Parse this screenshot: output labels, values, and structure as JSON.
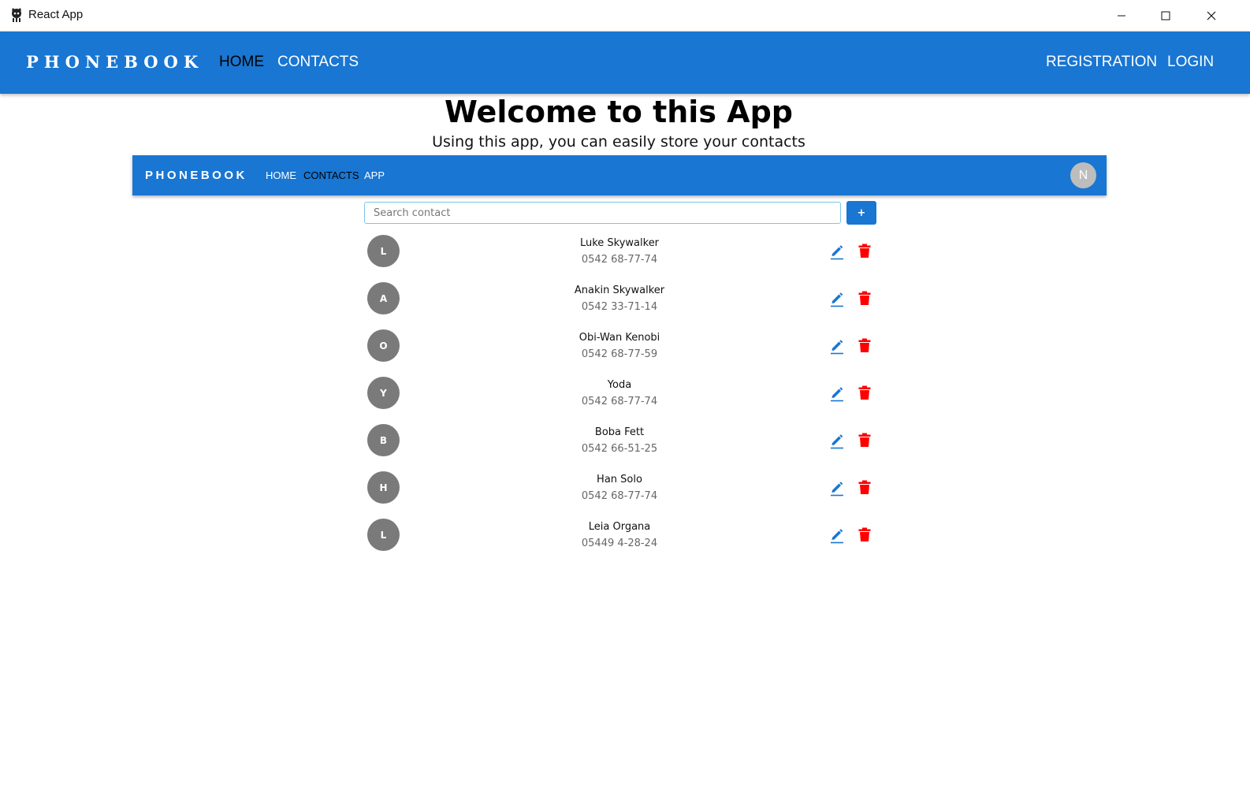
{
  "window": {
    "title": "React App"
  },
  "colors": {
    "primary": "#1976d2",
    "danger": "#ff0000",
    "avatar": "#7a7a7a",
    "text": "#111111"
  },
  "header": {
    "brand": "PHONEBOOK",
    "nav": [
      {
        "label": "HOME",
        "active": true
      },
      {
        "label": "CONTACTS",
        "active": false
      }
    ],
    "auth": [
      {
        "label": "REGISTRATION"
      },
      {
        "label": "LOGIN"
      }
    ]
  },
  "hero": {
    "title": "Welcome to this App",
    "subtitle": "Using this app, you can easily store your contacts"
  },
  "inner_app": {
    "brand": "PHONEBOOK",
    "nav": [
      {
        "label": "HOME",
        "active": false
      },
      {
        "label": "CONTACTS",
        "active": true
      },
      {
        "label": "APP",
        "active": false
      }
    ],
    "user_initial": "N",
    "search_placeholder": "Search contact",
    "add_label": "+",
    "contacts": [
      {
        "initial": "L",
        "name": "Luke Skywalker",
        "phone": "0542 68-77-74"
      },
      {
        "initial": "A",
        "name": "Anakin Skywalker",
        "phone": "0542 33-71-14"
      },
      {
        "initial": "O",
        "name": "Obi-Wan Kenobi",
        "phone": "0542 68-77-59"
      },
      {
        "initial": "Y",
        "name": "Yoda",
        "phone": "0542 68-77-74"
      },
      {
        "initial": "B",
        "name": "Boba Fett",
        "phone": "0542 66-51-25"
      },
      {
        "initial": "H",
        "name": "Han Solo",
        "phone": "0542 68-77-74"
      },
      {
        "initial": "L",
        "name": "Leia Organa",
        "phone": "05449 4-28-24"
      }
    ]
  },
  "icons": {
    "app": "octocat-icon",
    "minimize": "minimize-icon",
    "maximize": "maximize-icon",
    "close": "close-icon",
    "edit": "pencil-icon",
    "delete": "trash-icon"
  }
}
